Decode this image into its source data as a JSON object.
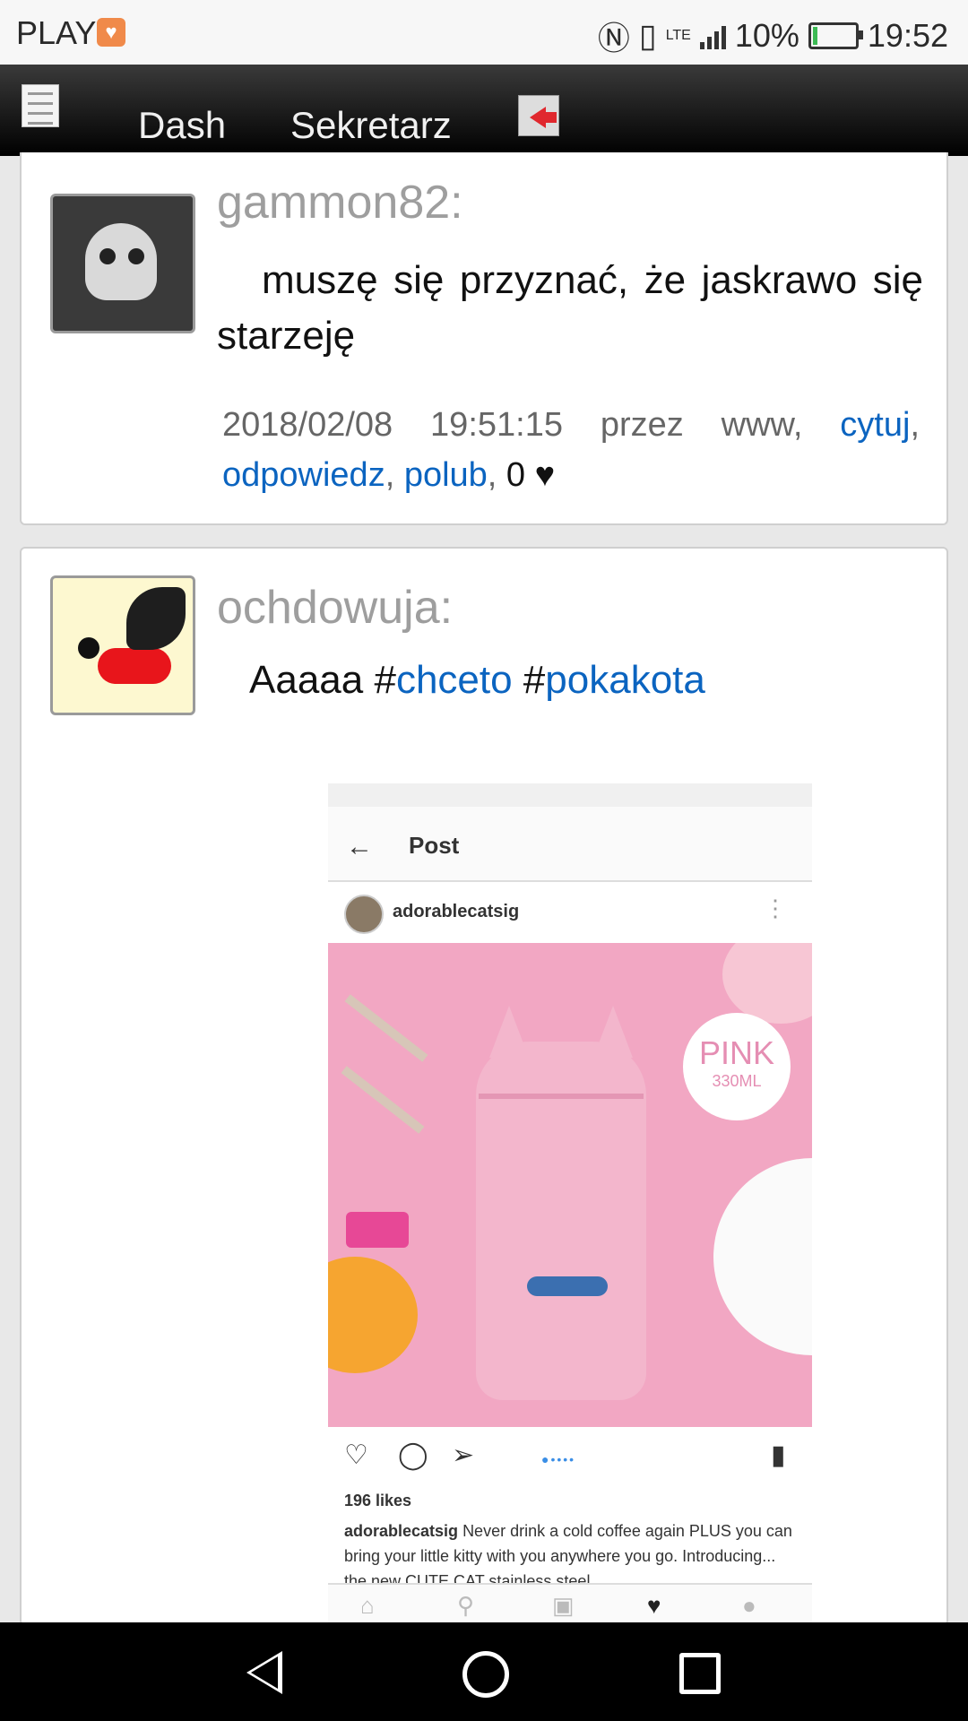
{
  "status_bar": {
    "carrier": "PLAY",
    "battery": "10%",
    "battery_level": 0.1,
    "network": "LTE",
    "time": "19:52"
  },
  "nav": {
    "menu_icon": "document-menu-icon",
    "tabs": [
      "Dash",
      "Sekretarz"
    ],
    "logout_icon": "logout-icon"
  },
  "posts": [
    {
      "author": "gammon82:",
      "text": "muszę się przyznać, że jaskrawo się starzeję",
      "meta_date": "2018/02/08 19:51:15 przez www,",
      "actions": [
        "cytuj",
        "odpowiedz",
        "polub"
      ],
      "likes": "0 ♥"
    },
    {
      "author": "ochdowuja:",
      "text_prefix": "Aaaaa #",
      "hashtag1": "chceto",
      "hash2": " #",
      "hashtag2": "pokakota",
      "embed": {
        "header": "Post",
        "username": "adorablecatsig",
        "badge_title": "PINK",
        "badge_sub": "330ML",
        "likes": "196 likes",
        "caption_user": "adorablecatsig",
        "caption_text": "Never drink a cold coffee again PLUS you can bring your little kitty with you anywhere you go. Introducing... the new CUTE CAT stainless steel"
      }
    }
  ]
}
